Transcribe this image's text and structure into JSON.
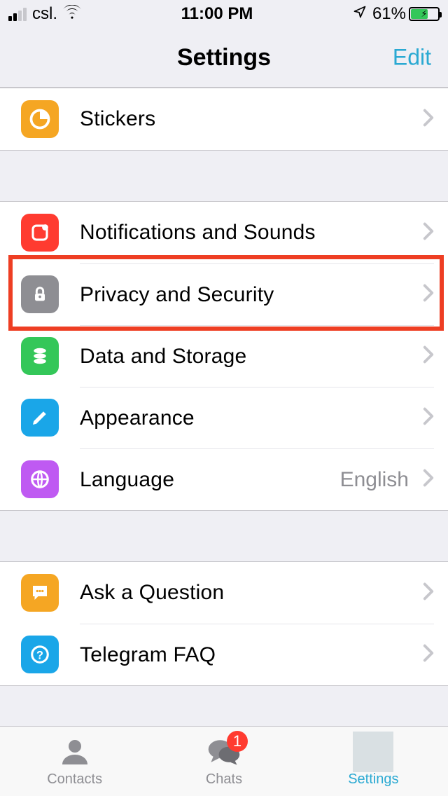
{
  "status": {
    "carrier": "csl.",
    "time": "11:00 PM",
    "battery_percent": "61%"
  },
  "header": {
    "title": "Settings",
    "edit": "Edit"
  },
  "groups": [
    {
      "rows": [
        {
          "id": "stickers",
          "label": "Stickers",
          "icon": "stickers-icon",
          "icon_bg": "#f5a623",
          "value": ""
        }
      ]
    },
    {
      "rows": [
        {
          "id": "notifications",
          "label": "Notifications and Sounds",
          "icon": "bell-icon",
          "icon_bg": "#ff3b30",
          "value": ""
        },
        {
          "id": "privacy",
          "label": "Privacy and Security",
          "icon": "lock-icon",
          "icon_bg": "#8e8e93",
          "value": "",
          "highlighted": true
        },
        {
          "id": "data",
          "label": "Data and Storage",
          "icon": "storage-icon",
          "icon_bg": "#34c759",
          "value": ""
        },
        {
          "id": "appearance",
          "label": "Appearance",
          "icon": "brush-icon",
          "icon_bg": "#1aa6e8",
          "value": ""
        },
        {
          "id": "language",
          "label": "Language",
          "icon": "globe-icon",
          "icon_bg": "#bf5af2",
          "value": "English"
        }
      ]
    },
    {
      "rows": [
        {
          "id": "ask",
          "label": "Ask a Question",
          "icon": "chat-icon",
          "icon_bg": "#f5a623",
          "value": ""
        },
        {
          "id": "faq",
          "label": "Telegram FAQ",
          "icon": "help-icon",
          "icon_bg": "#1aa6e8",
          "value": ""
        }
      ]
    }
  ],
  "tabs": {
    "contacts": {
      "label": "Contacts"
    },
    "chats": {
      "label": "Chats",
      "badge": "1"
    },
    "settings": {
      "label": "Settings"
    }
  },
  "highlight_target": "privacy"
}
